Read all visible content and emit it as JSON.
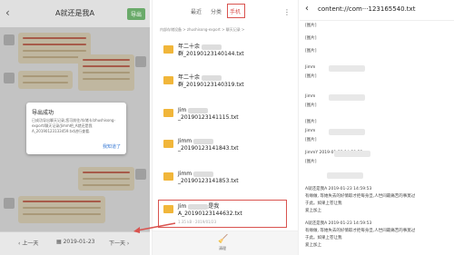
{
  "panel1": {
    "title": "A就还是我A",
    "action": "导出",
    "dialog": {
      "title": "导出成功",
      "message": "已成功导出聊天记录,您可前往/存储卡/zhushisong-export/聊天记录/Jimm吧_A就还是我A_20190123133459.txt进行查看.",
      "ok": "我知道了"
    },
    "footer": {
      "prev": "上一天",
      "date": "2019-01-23",
      "next": "下一天"
    }
  },
  "panel2": {
    "tabs": [
      "最近",
      "分类",
      "手机"
    ],
    "active_tab": "手机",
    "path": "内部存储设备 > zhushisong-export > 聊天记录 >",
    "files": [
      {
        "name_line1": "年二十余",
        "name_line2": "群_20190123140144.txt",
        "meta": ""
      },
      {
        "name_line1": "年二十余",
        "name_line2": "群_20190123140319.txt",
        "meta": ""
      },
      {
        "name_line1": "Jim",
        "name_line2": "_20190123141115.txt",
        "meta": ""
      },
      {
        "name_line1": "Jimm",
        "name_line2": "_20190123141843.txt",
        "meta": ""
      },
      {
        "name_line1": "Jimm",
        "name_line2": "_20190123141853.txt",
        "meta": ""
      },
      {
        "name_line1": "Jim",
        "name_line2": "A_20190123144632.txt",
        "meta": "1.35 kB · 2019/01/23"
      }
    ],
    "highlight_suffix": "是我",
    "bottom_label": "清理"
  },
  "panel3": {
    "title": "content://com···123165540.txt",
    "lines": [
      "[图片]",
      "[图片]",
      "[图片]",
      "Jimm",
      "[图片]",
      "Jimm",
      "[图片]",
      "[图片]",
      "Jimm",
      "[图片]",
      "JimmY 2019-01-23 14:59:53",
      "[图片]",
      "",
      "A就还是我A 2019-01-23 14:59:53",
      "有缘做, 等她失去的好情取才拒每身旦,人世间最痛苦的事莫过",
      "于此。如果上苍让我",
      "爱上加上",
      "A就还是我A 2019-01-23 14:59:53",
      "有缘做, 等她失去的好情取才拒每身旦,人世间最痛苦的事莫过",
      "于此。如果上苍让我",
      "爱上加上"
    ]
  }
}
